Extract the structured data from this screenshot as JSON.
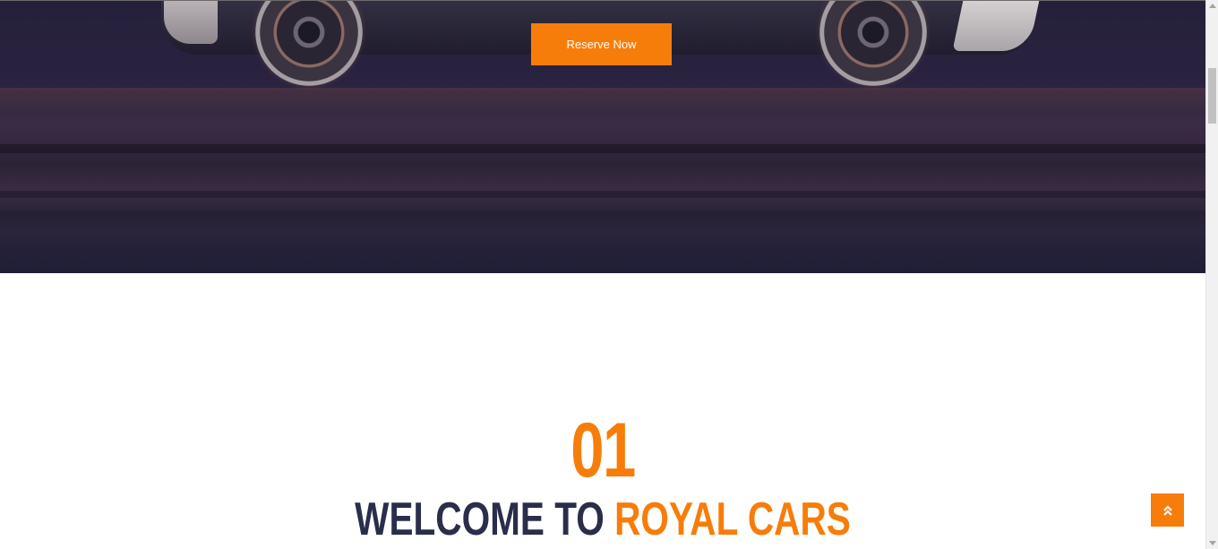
{
  "hero": {
    "reserve_button_label": "Reserve Now"
  },
  "welcome": {
    "number": "01",
    "title_part1": "WELCOME TO ",
    "title_part2": "ROYAL CARS"
  },
  "icons": {
    "back_to_top": "double-chevron-up-icon"
  },
  "colors": {
    "accent": "#f77d0a",
    "dark": "#2b2e4a",
    "hero_bg": "#25203a"
  }
}
